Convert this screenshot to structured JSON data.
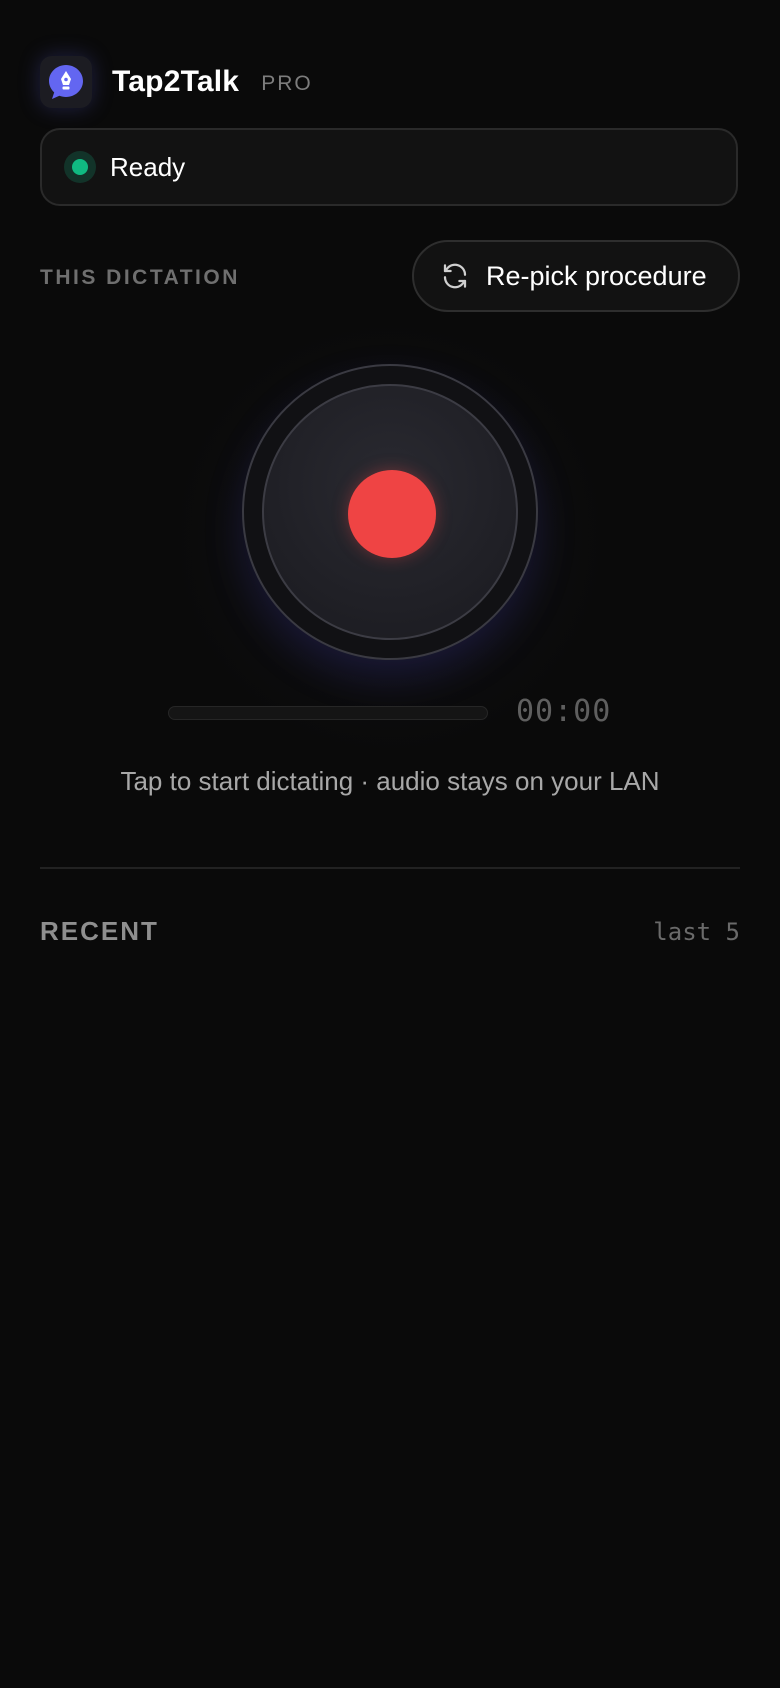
{
  "app": {
    "title": "Tap2Talk",
    "tier": "PRO",
    "logo_icon": "pen-nib-chat-bubble-icon",
    "accent_color": "#6366f1"
  },
  "status": {
    "text": "Ready",
    "dot_color": "#10b981"
  },
  "dictation": {
    "section_label": "THIS DICTATION",
    "repick_label": "Re-pick procedure",
    "repick_icon": "refresh-icon"
  },
  "recorder": {
    "button_icon": "record-dot-icon",
    "record_color": "#ef4444",
    "level": 0,
    "timer": "00:00",
    "hint": "Tap to start dictating · audio stays on your LAN"
  },
  "recent": {
    "label": "RECENT",
    "count_label": "last 5",
    "items": []
  }
}
